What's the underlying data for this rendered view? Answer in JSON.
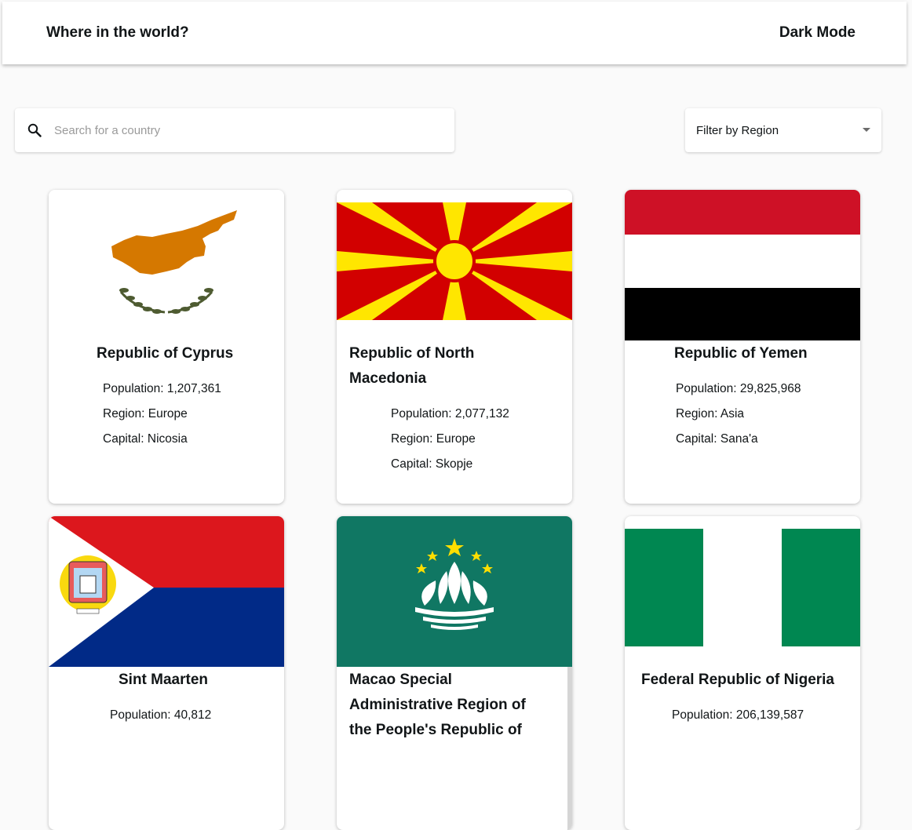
{
  "header": {
    "title": "Where in the world?",
    "theme_toggle_label": "Dark Mode",
    "theme_icon": "moon-icon"
  },
  "search": {
    "placeholder": "Search for a country",
    "value": "",
    "icon": "search-icon"
  },
  "filter": {
    "label": "Filter by Region",
    "icon": "chevron-down-icon"
  },
  "countries": [
    {
      "name": "Republic of Cyprus",
      "population_label": "Population:",
      "population": "1,207,361",
      "region_label": "Region:",
      "region": "Europe",
      "capital_label": "Capital:",
      "capital": "Nicosia",
      "flag": "cyprus-flag"
    },
    {
      "name_line1": "Republic of North",
      "name_line2": "Macedonia",
      "population_label": "Population:",
      "population": "2,077,132",
      "region_label": "Region:",
      "region": "Europe",
      "capital_label": "Capital:",
      "capital": "Skopje",
      "flag": "north-macedonia-flag"
    },
    {
      "name": "Republic of Yemen",
      "population_label": "Population:",
      "population": "29,825,968",
      "region_label": "Region:",
      "region": "Asia",
      "capital_label": "Capital:",
      "capital": "Sana'a",
      "flag": "yemen-flag"
    },
    {
      "name": "Sint Maarten",
      "population_label": "Population:",
      "population": "40,812",
      "flag": "sint-maarten-flag"
    },
    {
      "name_line1": "Macao Special",
      "name_line2": "Administrative Region of",
      "name_line3": "the People's Republic of",
      "flag": "macao-flag"
    },
    {
      "name": "Federal Republic of Nigeria",
      "population_label": "Population:",
      "population": "206,139,587",
      "flag": "nigeria-flag"
    }
  ],
  "colors": {
    "background": "#fafafa",
    "card": "#ffffff",
    "text": "#111517"
  }
}
